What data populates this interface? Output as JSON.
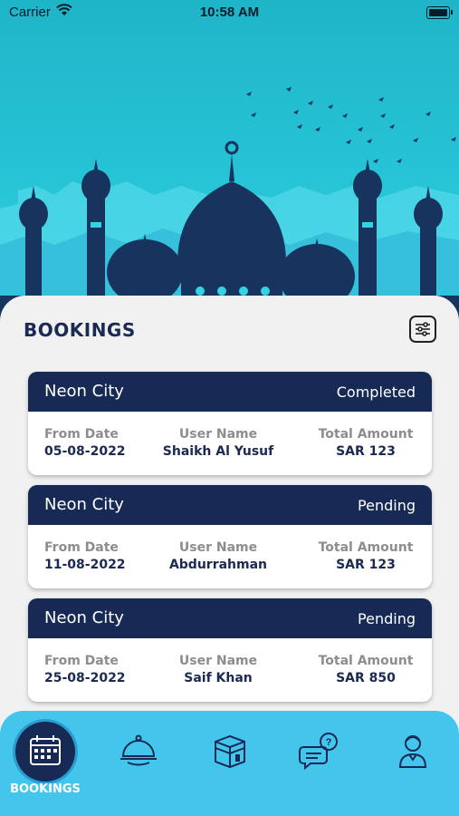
{
  "status_bar": {
    "carrier": "Carrier",
    "time": "10:58 AM"
  },
  "page_title": "BOOKINGS",
  "labels": {
    "from_date": "From Date",
    "user_name": "User Name",
    "total_amount": "Total Amount"
  },
  "bookings": [
    {
      "name": "Neon City",
      "status": "Completed",
      "from_date": "05-08-2022",
      "user_name": "Shaikh Al Yusuf",
      "total_amount": "SAR 123"
    },
    {
      "name": "Neon City",
      "status": "Pending",
      "from_date": "11-08-2022",
      "user_name": "Abdurrahman",
      "total_amount": "SAR 123"
    },
    {
      "name": "Neon City",
      "status": "Pending",
      "from_date": "25-08-2022",
      "user_name": "Saif Khan",
      "total_amount": "SAR 850"
    }
  ],
  "tabbar": {
    "tabs": [
      {
        "icon": "calendar-icon",
        "label": "BOOKINGS",
        "active": true
      },
      {
        "icon": "food-cloche-icon"
      },
      {
        "icon": "kaaba-icon"
      },
      {
        "icon": "chat-help-icon"
      },
      {
        "icon": "user-profile-icon"
      }
    ]
  },
  "colors": {
    "header": "#172a55",
    "tabbar": "#44c6ec",
    "hero": "#27c3d6"
  }
}
